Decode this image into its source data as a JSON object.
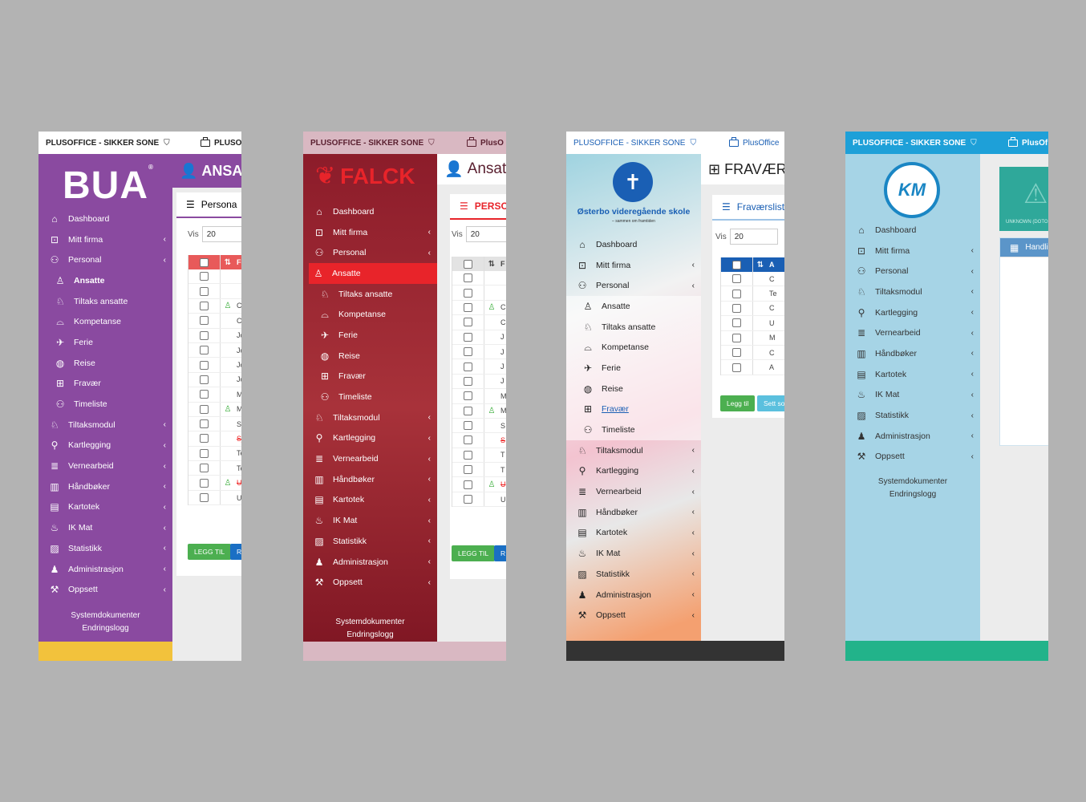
{
  "panels": [
    {
      "brand": "BUA",
      "topbar": {
        "title": "PLUSOFFICE - SIKKER SONE",
        "company": "PLUSO"
      },
      "logo": "BUA",
      "page_title": "ANSATT",
      "card_title": "Persona",
      "vis_label": "Vis",
      "vis_value": "20",
      "col_header": "Fo",
      "rows": [
        "Cl",
        "Cl",
        "Jo",
        "Jo",
        "Jo",
        "Jo",
        "Mi",
        "M",
        "Sp",
        "Sj",
        "Te",
        "Te",
        "Ul",
        "Ul"
      ],
      "legg_til": "LEGG TIL",
      "btn2": "R",
      "colors": {
        "sidebar": "#8a4aa0",
        "header": "#e85a5a",
        "footer": "#f2c23c"
      },
      "nav": [
        {
          "label": "Dashboard",
          "icon": "home-icon"
        },
        {
          "label": "Mitt firma",
          "icon": "briefcase-icon",
          "chev": "‹"
        },
        {
          "label": "Personal",
          "icon": "users-icon",
          "chev": "‹"
        },
        {
          "label": "Ansatte",
          "icon": "user-icon",
          "sub": true,
          "bold": true
        },
        {
          "label": "Tiltaks ansatte",
          "icon": "user-hand-icon",
          "sub": true
        },
        {
          "label": "Kompetanse",
          "icon": "graduation-cap-icon",
          "sub": true
        },
        {
          "label": "Ferie",
          "icon": "plane-icon",
          "sub": true
        },
        {
          "label": "Reise",
          "icon": "globe-icon",
          "sub": true
        },
        {
          "label": "Fravær",
          "icon": "medkit-icon",
          "sub": true
        },
        {
          "label": "Timeliste",
          "icon": "users-icon",
          "sub": true
        },
        {
          "label": "Tiltaksmodul",
          "icon": "user-hand-icon",
          "chev": "‹"
        },
        {
          "label": "Kartlegging",
          "icon": "search-icon",
          "chev": "‹"
        },
        {
          "label": "Vernearbeid",
          "icon": "list-icon",
          "chev": "‹"
        },
        {
          "label": "Håndbøker",
          "icon": "books-icon",
          "chev": "‹"
        },
        {
          "label": "Kartotek",
          "icon": "file-icon",
          "chev": "‹"
        },
        {
          "label": "IK Mat",
          "icon": "chef-hat-icon",
          "chev": "‹"
        },
        {
          "label": "Statistikk",
          "icon": "chart-icon",
          "chev": "‹"
        },
        {
          "label": "Administrasjon",
          "icon": "user-shield-icon",
          "chev": "‹"
        },
        {
          "label": "Oppsett",
          "icon": "wrench-icon",
          "chev": "‹"
        }
      ],
      "footer_links": [
        "Systemdokumenter",
        "Endringslogg"
      ]
    },
    {
      "brand": "FALCK",
      "topbar": {
        "title": "PLUSOFFICE - SIKKER SONE",
        "company": "PlusO"
      },
      "logo": "FALCK",
      "page_title": "Ansatt",
      "card_title": "PERSO",
      "vis_label": "Vis",
      "vis_value": "20",
      "col_header": "F",
      "rows": [
        "C",
        "C",
        "J",
        "J",
        "J",
        "J",
        "M",
        "M",
        "S",
        "S",
        "T",
        "T",
        "U",
        "U"
      ],
      "legg_til": "LEGG TIL",
      "btn2": "R",
      "colors": {
        "sidebar": "#8c1c2a",
        "active": "#e8242a"
      },
      "nav": [
        {
          "label": "Dashboard",
          "icon": "home-icon"
        },
        {
          "label": "Mitt firma",
          "icon": "briefcase-icon",
          "chev": "‹"
        },
        {
          "label": "Personal",
          "icon": "users-icon",
          "chev": "‹"
        },
        {
          "label": "Ansatte",
          "icon": "user-icon",
          "sub": true,
          "active": true
        },
        {
          "label": "Tiltaks ansatte",
          "icon": "user-hand-icon",
          "sub": true
        },
        {
          "label": "Kompetanse",
          "icon": "graduation-cap-icon",
          "sub": true
        },
        {
          "label": "Ferie",
          "icon": "plane-icon",
          "sub": true
        },
        {
          "label": "Reise",
          "icon": "globe-icon",
          "sub": true
        },
        {
          "label": "Fravær",
          "icon": "medkit-icon",
          "sub": true
        },
        {
          "label": "Timeliste",
          "icon": "users-icon",
          "sub": true
        },
        {
          "label": "Tiltaksmodul",
          "icon": "user-hand-icon",
          "chev": "‹"
        },
        {
          "label": "Kartlegging",
          "icon": "search-icon",
          "chev": "‹"
        },
        {
          "label": "Vernearbeid",
          "icon": "list-icon",
          "chev": "‹"
        },
        {
          "label": "Håndbøker",
          "icon": "books-icon",
          "chev": "‹"
        },
        {
          "label": "Kartotek",
          "icon": "file-icon",
          "chev": "‹"
        },
        {
          "label": "IK Mat",
          "icon": "chef-hat-icon",
          "chev": "‹"
        },
        {
          "label": "Statistikk",
          "icon": "chart-icon",
          "chev": "‹"
        },
        {
          "label": "Administrasjon",
          "icon": "user-shield-icon",
          "chev": "‹"
        },
        {
          "label": "Oppsett",
          "icon": "wrench-icon",
          "chev": "‹"
        }
      ],
      "footer_links": [
        "Systemdokumenter",
        "Endringslogg"
      ]
    },
    {
      "brand": "Østerbo",
      "topbar": {
        "title": "PLUSOFFICE - SIKKER SONE",
        "company": "PlusOffice"
      },
      "logo_text": "Østerbo videregående skole",
      "logo_sub": "– sammen om framtiden",
      "page_title": "FRAVÆR",
      "card_title": "Fraværslist",
      "vis_label": "Vis",
      "vis_value": "20",
      "col_header": "A",
      "rows": [
        "C",
        "Te",
        "C",
        "U",
        "M",
        "C",
        "A"
      ],
      "legg_til": "Legg til",
      "btn2": "Sett som",
      "colors": {
        "accent": "#1a5fb4",
        "add": "#4caf50",
        "btn2": "#5bc0de"
      },
      "nav": [
        {
          "label": "Dashboard",
          "icon": "home-icon"
        },
        {
          "label": "Mitt firma",
          "icon": "briefcase-icon",
          "chev": "‹"
        },
        {
          "label": "Personal",
          "icon": "users-icon",
          "chev": "‹"
        },
        {
          "label": "Ansatte",
          "icon": "user-icon",
          "sub": true
        },
        {
          "label": "Tiltaks ansatte",
          "icon": "user-hand-icon",
          "sub": true
        },
        {
          "label": "Kompetanse",
          "icon": "graduation-cap-icon",
          "sub": true
        },
        {
          "label": "Ferie",
          "icon": "plane-icon",
          "sub": true
        },
        {
          "label": "Reise",
          "icon": "globe-icon",
          "sub": true
        },
        {
          "label": "Fravær",
          "icon": "medkit-icon",
          "sub": true,
          "link": true
        },
        {
          "label": "Timeliste",
          "icon": "users-icon",
          "sub": true
        },
        {
          "label": "Tiltaksmodul",
          "icon": "user-hand-icon",
          "chev": "‹"
        },
        {
          "label": "Kartlegging",
          "icon": "search-icon",
          "chev": "‹"
        },
        {
          "label": "Vernearbeid",
          "icon": "list-icon",
          "chev": "‹"
        },
        {
          "label": "Håndbøker",
          "icon": "books-icon",
          "chev": "‹"
        },
        {
          "label": "Kartotek",
          "icon": "file-icon",
          "chev": "‹"
        },
        {
          "label": "IK Mat",
          "icon": "chef-hat-icon",
          "chev": "‹"
        },
        {
          "label": "Statistikk",
          "icon": "chart-icon",
          "chev": "‹"
        },
        {
          "label": "Administrasjon",
          "icon": "user-shield-icon",
          "chev": "‹"
        },
        {
          "label": "Oppsett",
          "icon": "wrench-icon",
          "chev": "‹"
        }
      ]
    },
    {
      "brand": "KM",
      "topbar": {
        "title": "PLUSOFFICE - SIKKER SONE",
        "company": "PlusOf"
      },
      "logo": "KM",
      "green_card_text": "UNKNOWN (DOTO",
      "card_title": "Handlin",
      "colors": {
        "topbar": "#1ea0d8",
        "sidebar": "#a6d4e6",
        "footer": "#22b38a",
        "card": "#2fa89a"
      },
      "nav": [
        {
          "label": "Dashboard",
          "icon": "home-icon"
        },
        {
          "label": "Mitt firma",
          "icon": "briefcase-icon",
          "chev": "‹"
        },
        {
          "label": "Personal",
          "icon": "users-icon",
          "chev": "‹"
        },
        {
          "label": "Tiltaksmodul",
          "icon": "user-hand-icon",
          "chev": "‹"
        },
        {
          "label": "Kartlegging",
          "icon": "search-icon",
          "chev": "‹"
        },
        {
          "label": "Vernearbeid",
          "icon": "list-icon",
          "chev": "‹"
        },
        {
          "label": "Håndbøker",
          "icon": "books-icon",
          "chev": "‹"
        },
        {
          "label": "Kartotek",
          "icon": "file-icon",
          "chev": "‹"
        },
        {
          "label": "IK Mat",
          "icon": "chef-hat-icon",
          "chev": "‹"
        },
        {
          "label": "Statistikk",
          "icon": "chart-icon",
          "chev": "‹"
        },
        {
          "label": "Administrasjon",
          "icon": "user-shield-icon",
          "chev": "‹"
        },
        {
          "label": "Oppsett",
          "icon": "wrench-icon",
          "chev": "‹"
        }
      ],
      "footer_links": [
        "Systemdokumenter",
        "Endringslogg"
      ]
    }
  ]
}
